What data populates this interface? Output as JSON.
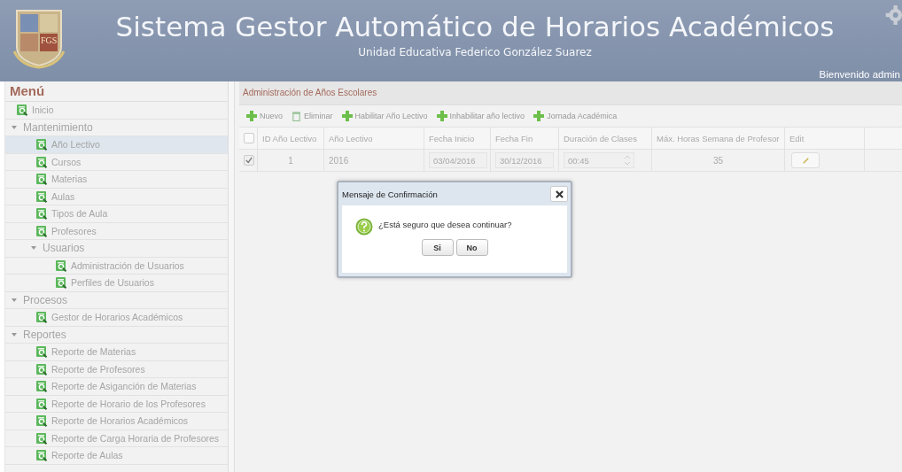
{
  "header": {
    "logo_text": "FGS",
    "title": "Sistema Gestor Automático de Horarios Académicos",
    "subtitle": "Unidad Educativa Federico González Suarez",
    "welcome": "Bienvenido admin"
  },
  "menu": {
    "title": "Menú",
    "items": [
      {
        "label": "Inicio",
        "kind": "leaf",
        "selected": false
      },
      {
        "label": "Mantenimiento",
        "kind": "group",
        "expanded": true,
        "children": [
          {
            "label": "Año Lectivo",
            "kind": "leaf",
            "selected": true
          },
          {
            "label": "Cursos",
            "kind": "leaf",
            "selected": false
          },
          {
            "label": "Materias",
            "kind": "leaf",
            "selected": false
          },
          {
            "label": "Aulas",
            "kind": "leaf",
            "selected": false
          },
          {
            "label": "Tipos de Aula",
            "kind": "leaf",
            "selected": false
          },
          {
            "label": "Profesores",
            "kind": "leaf",
            "selected": false
          },
          {
            "label": "Usuarios",
            "kind": "group",
            "expanded": true,
            "children": [
              {
                "label": "Administración de Usuarios",
                "kind": "leaf",
                "selected": false
              },
              {
                "label": "Perfiles de Usuarios",
                "kind": "leaf",
                "selected": false
              }
            ]
          }
        ]
      },
      {
        "label": "Procesos",
        "kind": "group",
        "expanded": true,
        "children": [
          {
            "label": "Gestor de Horarios Académicos",
            "kind": "leaf",
            "selected": false
          }
        ]
      },
      {
        "label": "Reportes",
        "kind": "group",
        "expanded": true,
        "children": [
          {
            "label": "Reporte de Materias",
            "kind": "leaf",
            "selected": false
          },
          {
            "label": "Reporte de Profesores",
            "kind": "leaf",
            "selected": false
          },
          {
            "label": "Reporte de Asiganción de Materias",
            "kind": "leaf",
            "selected": false
          },
          {
            "label": "Reporte de Horario de los Profesores",
            "kind": "leaf",
            "selected": false
          },
          {
            "label": "Reporte de Horarios Académicos",
            "kind": "leaf",
            "selected": false
          },
          {
            "label": "Reporte de Carga Horaria de Profesores",
            "kind": "leaf",
            "selected": false
          },
          {
            "label": "Reporte de Aulas",
            "kind": "leaf",
            "selected": false
          }
        ]
      }
    ]
  },
  "panel": {
    "title": "Administración de Años Escolares"
  },
  "toolbar": [
    {
      "label": "Nuevo",
      "kind": "add"
    },
    {
      "label": "Eliminar",
      "kind": "delete"
    },
    {
      "label": "Habilitar Año Lectivo",
      "kind": "add"
    },
    {
      "label": "Inhabilitar año lectivo",
      "kind": "add"
    },
    {
      "label": "Jornada Académica",
      "kind": "add"
    }
  ],
  "table": {
    "header_checked": false,
    "columns": [
      "ID Año Lectivo",
      "Año Lectivo",
      "Fecha Inicio",
      "Fecha Fin",
      "Duración de Clases",
      "Máx. Horas Semana de Profesor",
      "Edit"
    ],
    "rows": [
      {
        "checked": true,
        "id": "1",
        "year": "2016",
        "start": "03/04/2016",
        "end": "30/12/2016",
        "duration": "00:45",
        "max_hours": "35"
      }
    ]
  },
  "dialog": {
    "title": "Mensaje de Confirmación",
    "message": "¿Está seguro que desea continuar?",
    "buttons": [
      "Si",
      "No"
    ]
  }
}
